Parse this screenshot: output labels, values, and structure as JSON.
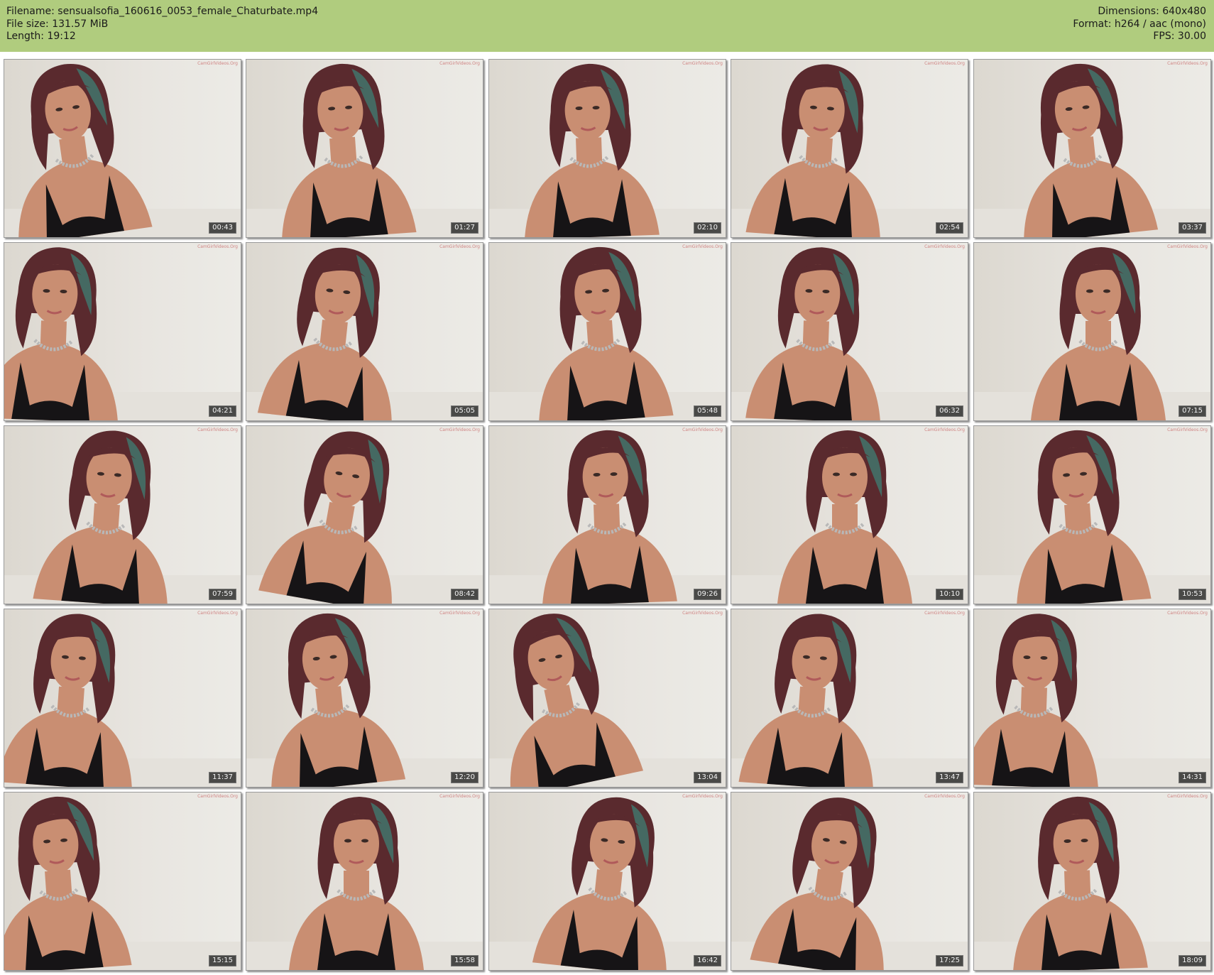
{
  "header": {
    "filename": "Filename: sensualsofia_160616_0053_female_Chaturbate.mp4",
    "filesize": "File size: 131.57 MiB",
    "length": "Length: 19:12",
    "dimensions": "Dimensions: 640x480",
    "format": "Format: h264 / aac (mono)",
    "fps": "FPS: 30.00"
  },
  "colors": {
    "header_bg": "#b0cc7e",
    "hair": "#5a2a2e",
    "hair_tint": "#3f7f74",
    "skin": "#c98e72",
    "top": "#161416",
    "necklace": "#b8b8b8"
  },
  "watermark": "CamGirlVideos.Org",
  "frames": [
    {
      "time": "00:43"
    },
    {
      "time": "01:27"
    },
    {
      "time": "02:10"
    },
    {
      "time": "02:54"
    },
    {
      "time": "03:37"
    },
    {
      "time": "04:21"
    },
    {
      "time": "05:05"
    },
    {
      "time": "05:48"
    },
    {
      "time": "06:32"
    },
    {
      "time": "07:15"
    },
    {
      "time": "07:59"
    },
    {
      "time": "08:42"
    },
    {
      "time": "09:26"
    },
    {
      "time": "10:10"
    },
    {
      "time": "10:53"
    },
    {
      "time": "11:37"
    },
    {
      "time": "12:20"
    },
    {
      "time": "13:04"
    },
    {
      "time": "13:47"
    },
    {
      "time": "14:31"
    },
    {
      "time": "15:15"
    },
    {
      "time": "15:58"
    },
    {
      "time": "16:42"
    },
    {
      "time": "17:25"
    },
    {
      "time": "18:09"
    }
  ]
}
